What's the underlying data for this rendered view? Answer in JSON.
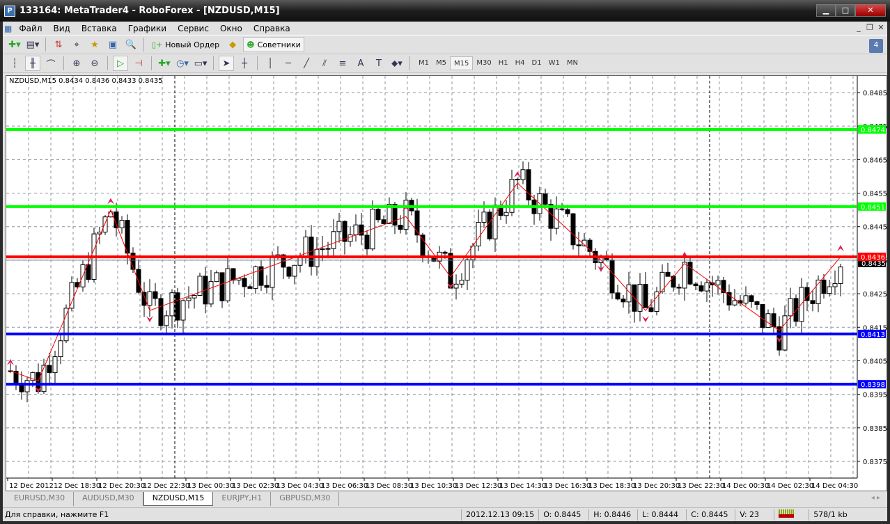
{
  "window": {
    "title": "133164: MetaTrader4 - RoboForex - [NZDUSD,M15]"
  },
  "menu": [
    "Файл",
    "Вид",
    "Вставка",
    "Графики",
    "Сервис",
    "Окно",
    "Справка"
  ],
  "toolbar": {
    "new_order": "Новый Ордер",
    "experts": "Советники",
    "notifications": "4"
  },
  "timeframes": [
    "M1",
    "M5",
    "M15",
    "M30",
    "H1",
    "H4",
    "D1",
    "W1",
    "MN"
  ],
  "active_timeframe": "M15",
  "chart": {
    "info": "NZDUSD,M15  0.8434 0.8436 0.8433 0.8435",
    "price_ticks": [
      "0.8485",
      "0.8475",
      "0.8465",
      "0.8455",
      "0.8445",
      "0.8435",
      "0.8425",
      "0.8415",
      "0.8405",
      "0.8395",
      "0.8385",
      "0.8375"
    ],
    "time_labels": [
      "12 Dec 2012",
      "12 Dec 18:30",
      "12 Dec 20:30",
      "12 Dec 22:30",
      "13 Dec 00:30",
      "13 Dec 02:30",
      "13 Dec 04:30",
      "13 Dec 06:30",
      "13 Dec 08:30",
      "13 Dec 10:30",
      "13 Dec 12:30",
      "13 Dec 14:30",
      "13 Dec 16:30",
      "13 Dec 18:30",
      "13 Dec 20:30",
      "13 Dec 22:30",
      "14 Dec 00:30",
      "14 Dec 02:30",
      "14 Dec 04:30"
    ],
    "current_price": "0.8435",
    "levels": [
      {
        "price": "0.8474",
        "color": "#00ff00"
      },
      {
        "price": "0.8451",
        "color": "#00ff00"
      },
      {
        "price": "0.8436",
        "color": "#ff0000"
      },
      {
        "price": "0.8413",
        "color": "#0000ff"
      },
      {
        "price": "0.8398",
        "color": "#0000ff"
      }
    ],
    "zigzag": [
      [
        0,
        0.8402
      ],
      [
        5,
        0.8399
      ],
      [
        18,
        0.845
      ],
      [
        25,
        0.842
      ],
      [
        71,
        0.8448
      ],
      [
        79,
        0.843
      ],
      [
        91,
        0.8458
      ],
      [
        106,
        0.8435
      ],
      [
        114,
        0.842
      ],
      [
        121,
        0.8434
      ],
      [
        138,
        0.8414
      ],
      [
        149,
        0.8436
      ]
    ],
    "zigzag_color": "#ff0000",
    "fractal_color": "#dd2255"
  },
  "tabs": [
    "EURUSD,M30",
    "AUDUSD,M30",
    "NZDUSD,M15",
    "EURJPY,H1",
    "GBPUSD,M30"
  ],
  "active_tab": "NZDUSD,M15",
  "status": {
    "help": "Для справки, нажмите F1",
    "time": "2012.12.13 09:15",
    "open": "O: 0.8445",
    "high": "H: 0.8446",
    "low": "L: 0.8444",
    "close": "C: 0.8445",
    "volume": "V: 23",
    "traffic": "578/1 kb"
  }
}
